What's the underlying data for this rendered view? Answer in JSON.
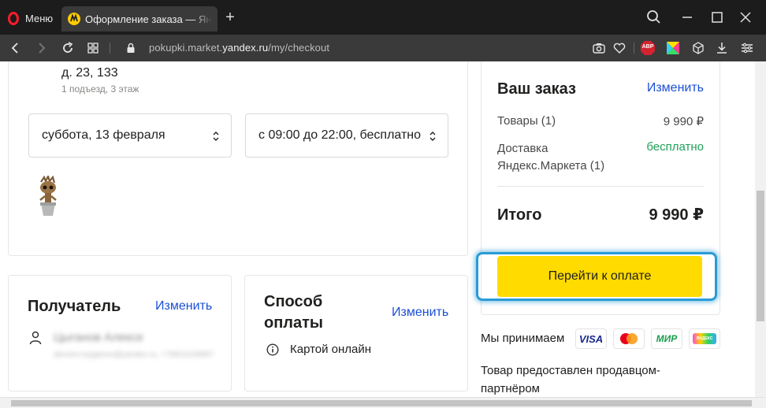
{
  "browser": {
    "menu_label": "Меню",
    "tab_title": "Оформление заказа — Ян",
    "url_prefix": "pokupki.market.",
    "url_domain": "yandex.ru",
    "url_path": "/my/checkout",
    "extensions": [
      "camera-icon",
      "heart-icon",
      "adblock-icon",
      "color-extension-icon",
      "cube-icon",
      "download-icon",
      "easy-setup-icon"
    ],
    "adblock_label": "ABP"
  },
  "delivery": {
    "address_line": "д. 23, 133",
    "address_detail": "1 подъезд, 3 этаж",
    "date_select": "суббота, 13 февраля",
    "time_select": "с 09:00 до 22:00, бесплатно"
  },
  "recipient": {
    "title": "Получатель",
    "edit_label": "Изменить",
    "name": "Цыганов Алексе",
    "contact": "alexeev.tsyganov@yandex.ru, +79815106897"
  },
  "payment": {
    "title": "Способ оплаты",
    "edit_label": "Изменить",
    "method": "Картой онлайн"
  },
  "order": {
    "title": "Ваш заказ",
    "edit_label": "Изменить",
    "items_label": "Товары (1)",
    "items_value": "9 990 ₽",
    "delivery_label": "Доставка Яндекс.Маркета (1)",
    "delivery_value": "бесплатно",
    "total_label": "Итого",
    "total_value": "9 990 ₽",
    "pay_button": "Перейти к оплате",
    "accept_label": "Мы принимаем",
    "cards": [
      "VISA",
      "mastercard",
      "МИР",
      "ЯНДЕКС"
    ],
    "seller_note": "Товар предоставлен продавцом-партнёром"
  },
  "colors": {
    "accent_yellow": "#ffdb00",
    "link_blue": "#1a4fd6",
    "free_green": "#21a05a",
    "highlight_blue": "#2a9bd5"
  }
}
